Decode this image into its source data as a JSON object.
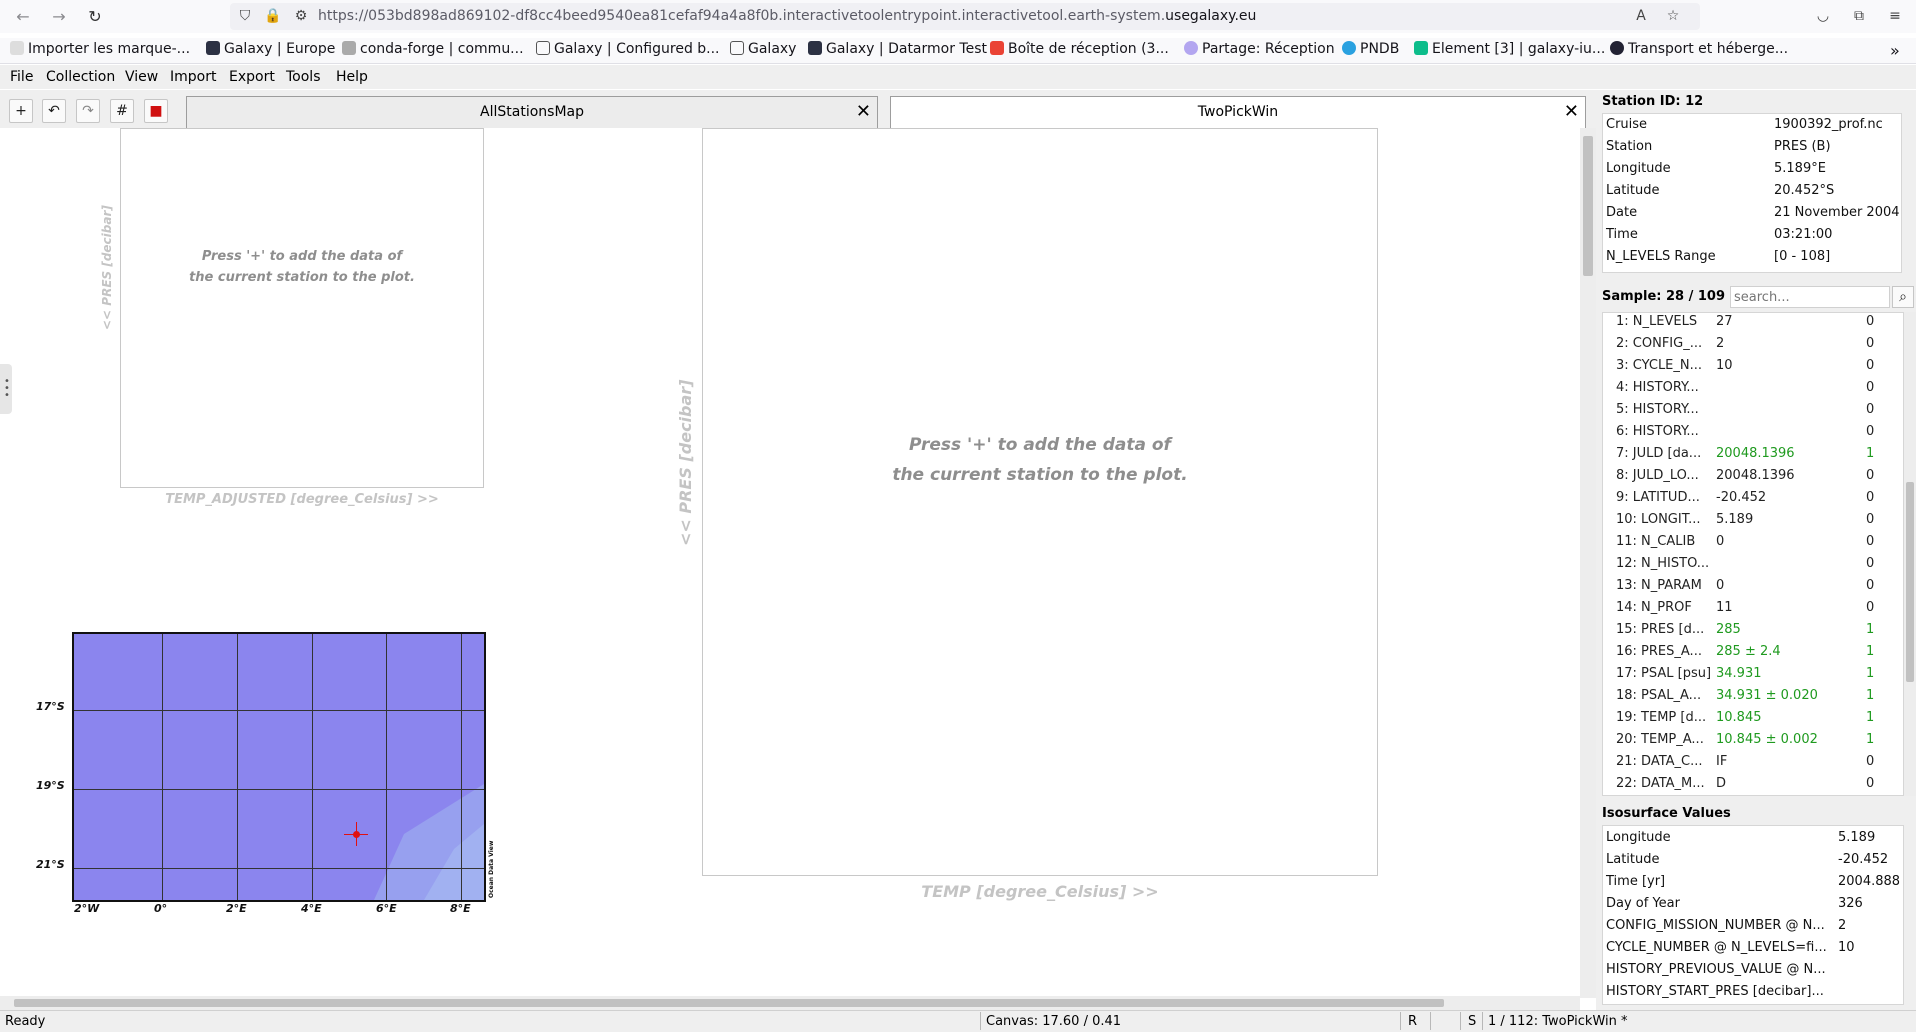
{
  "browser": {
    "url_prefix": "https://053bd898ad869102-df8cc4beed9540ea81cefaf94a4a8f0b.interactivetoolentrypoint.interactivetool.earth-system.",
    "url_domain": "usegalaxy.eu",
    "bookmarks": [
      "Importer les marque-...",
      "Galaxy | Europe",
      "conda-forge | commu...",
      "Galaxy | Configured b...",
      "Galaxy",
      "Galaxy | Datarmor Test",
      "Boîte de réception (3...",
      "Partage: Réception",
      "PNDB",
      "Element [3] | galaxy-iu...",
      "Transport et héberge..."
    ]
  },
  "menubar": {
    "items": [
      "File",
      "Collection",
      "View",
      "Import",
      "Export",
      "Tools",
      "Help"
    ]
  },
  "toolbar": {
    "add_label": "+",
    "undo_label": "↶",
    "redo_label": "↷",
    "grid_label": "#",
    "save_label": "■"
  },
  "tabs": [
    {
      "label": "AllStationsMap",
      "active": false
    },
    {
      "label": "TwoPickWin",
      "active": true
    }
  ],
  "canvas": {
    "small_plot": {
      "hint_line1": "Press '+' to add the data of",
      "hint_line2": "the current station to the plot.",
      "ylabel": "<< PRES [decibar]",
      "xlabel": "TEMP_ADJUSTED [degree_Celsius] >>"
    },
    "large_plot": {
      "hint_line1": "Press '+' to add the data of",
      "hint_line2": "the current station to the plot.",
      "ylabel": "<< PRES [decibar]",
      "xlabel": "TEMP [degree_Celsius] >>"
    },
    "map": {
      "lat_ticks": [
        "17°S",
        "19°S",
        "21°S"
      ],
      "lon_ticks": [
        "2°W",
        "0°",
        "2°E",
        "4°E",
        "6°E",
        "8°E"
      ],
      "credit": "Ocean Data View",
      "water_color": "#8b85ee",
      "marker_color": "#e01010"
    }
  },
  "station": {
    "title": "Station ID: 12",
    "rows": [
      {
        "k": "Cruise",
        "v": "1900392_prof.nc"
      },
      {
        "k": "Station",
        "v": "PRES (B)"
      },
      {
        "k": "Longitude",
        "v": "5.189°E"
      },
      {
        "k": "Latitude",
        "v": "20.452°S"
      },
      {
        "k": "Date",
        "v": "21 November 2004"
      },
      {
        "k": "Time",
        "v": "03:21:00"
      },
      {
        "k": "N_LEVELS Range",
        "v": "[0 - 108]"
      }
    ]
  },
  "sample": {
    "title": "Sample: 28 / 109",
    "search_placeholder": "search...",
    "rows": [
      {
        "n": "1: N_LEVELS",
        "v": "27",
        "f": "0",
        "hl": false
      },
      {
        "n": "2: CONFIG_...",
        "v": "2",
        "f": "0",
        "hl": false
      },
      {
        "n": "3: CYCLE_N...",
        "v": "10",
        "f": "0",
        "hl": false
      },
      {
        "n": "4: HISTORY...",
        "v": "",
        "f": "0",
        "hl": false
      },
      {
        "n": "5: HISTORY...",
        "v": "",
        "f": "0",
        "hl": false
      },
      {
        "n": "6: HISTORY...",
        "v": "",
        "f": "0",
        "hl": false
      },
      {
        "n": "7: JULD [da...",
        "v": "20048.1396",
        "f": "1",
        "hl": true
      },
      {
        "n": "8: JULD_LO...",
        "v": "20048.1396",
        "f": "0",
        "hl": false
      },
      {
        "n": "9: LATITUD...",
        "v": "-20.452",
        "f": "0",
        "hl": false
      },
      {
        "n": "10: LONGIT...",
        "v": "5.189",
        "f": "0",
        "hl": false
      },
      {
        "n": "11: N_CALIB",
        "v": "0",
        "f": "0",
        "hl": false
      },
      {
        "n": "12: N_HISTO...",
        "v": "",
        "f": "0",
        "hl": false
      },
      {
        "n": "13: N_PARAM",
        "v": "0",
        "f": "0",
        "hl": false
      },
      {
        "n": "14: N_PROF",
        "v": "11",
        "f": "0",
        "hl": false
      },
      {
        "n": "15: PRES [d...",
        "v": "285",
        "f": "1",
        "hl": true
      },
      {
        "n": "16: PRES_A...",
        "v": "285 ± 2.4",
        "f": "1",
        "hl": true
      },
      {
        "n": "17: PSAL [psu]",
        "v": "34.931",
        "f": "1",
        "hl": true
      },
      {
        "n": "18: PSAL_A...",
        "v": "34.931 ± 0.020",
        "f": "1",
        "hl": true
      },
      {
        "n": "19: TEMP [d...",
        "v": "10.845",
        "f": "1",
        "hl": true
      },
      {
        "n": "20: TEMP_A...",
        "v": "10.845 ± 0.002",
        "f": "1",
        "hl": true
      },
      {
        "n": "21: DATA_C...",
        "v": "IF",
        "f": "0",
        "hl": false
      },
      {
        "n": "22: DATA_M...",
        "v": "D",
        "f": "0",
        "hl": false
      }
    ]
  },
  "isosurface": {
    "title": "Isosurface Values",
    "rows": [
      {
        "k": "Longitude",
        "v": "5.189"
      },
      {
        "k": "Latitude",
        "v": "-20.452"
      },
      {
        "k": "Time [yr]",
        "v": "2004.888"
      },
      {
        "k": "Day of Year",
        "v": "326"
      },
      {
        "k": "CONFIG_MISSION_NUMBER @ N...",
        "v": "2"
      },
      {
        "k": "CYCLE_NUMBER @ N_LEVELS=fi...",
        "v": "10"
      },
      {
        "k": "HISTORY_PREVIOUS_VALUE @ N...",
        "v": ""
      },
      {
        "k": "HISTORY_START_PRES [decibar]...",
        "v": ""
      }
    ]
  },
  "status": {
    "ready": "Ready",
    "canvas": "Canvas:  17.60 / 0.41",
    "r": "R",
    "s": "S",
    "window": "1 / 112: TwoPickWin *"
  }
}
